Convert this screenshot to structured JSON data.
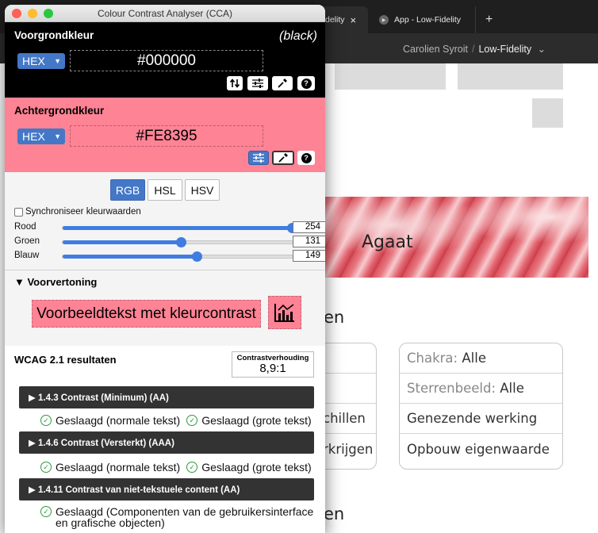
{
  "browser": {
    "tab1": {
      "label": "delity",
      "close": "×"
    },
    "tab2": {
      "label": "App - Low-Fidelity"
    },
    "new_tab": "+",
    "breadcrumb": {
      "user": "Carolien Syroit",
      "sep": "/",
      "project": "Low-Fidelity",
      "chev": "⌄"
    }
  },
  "page": {
    "hero_title": "Agaat",
    "heading1_fragment": "en",
    "heading2_fragment": "en",
    "left_fragments": [
      "chillen",
      "rkrijgen"
    ],
    "filters": [
      {
        "label": "Chakra:",
        "value": "Alle"
      },
      {
        "label": "Sterrenbeeld:",
        "value": "Alle"
      },
      {
        "label": "",
        "value": "Genezende werking"
      },
      {
        "label": "",
        "value": "Opbouw eigenwaarde"
      }
    ]
  },
  "cca": {
    "window_title": "Colour Contrast Analyser (CCA)",
    "foreground": {
      "title": "Voorgrondkleur",
      "color_name": "(black)",
      "format": "HEX",
      "hex": "#000000",
      "color": "#000000"
    },
    "background": {
      "title": "Achtergrondkleur",
      "format": "HEX",
      "hex": "#FE8395",
      "color": "#FE8395"
    },
    "modes": [
      "RGB",
      "HSL",
      "HSV"
    ],
    "active_mode": "RGB",
    "sync_label": "Synchroniseer kleurwaarden",
    "sync_checked": false,
    "sliders": [
      {
        "label": "Rood",
        "value": 254,
        "max": 255
      },
      {
        "label": "Groen",
        "value": 131,
        "max": 255
      },
      {
        "label": "Blauw",
        "value": 149,
        "max": 255
      }
    ],
    "preview": {
      "title": "▼ Voorvertoning",
      "sample_text": "Voorbeeldtekst met kleurcontrast"
    },
    "wcag": {
      "title": "WCAG 2.1 resultaten",
      "ratio_label": "Contrastverhouding",
      "ratio_value": "8,9:1",
      "criteria": [
        {
          "title": "▶ 1.4.3 Contrast (Minimum) (AA)",
          "results": [
            "Geslaagd (normale tekst)",
            "Geslaagd (grote tekst)"
          ]
        },
        {
          "title": "▶ 1.4.6 Contrast (Versterkt) (AAA)",
          "results": [
            "Geslaagd (normale tekst)",
            "Geslaagd (grote tekst)"
          ]
        },
        {
          "title": "▶ 1.4.11 Contrast van niet-tekstuele content (AA)",
          "results": [
            "Geslaagd (Componenten van de gebruikersinterface en grafische objecten)"
          ]
        }
      ]
    },
    "icons": {
      "swap": "swap-icon",
      "adjust": "sliders-icon",
      "picker": "eyedropper-icon",
      "help": "help-icon",
      "chart": "chart-icon",
      "check": "check-circle-icon"
    }
  }
}
